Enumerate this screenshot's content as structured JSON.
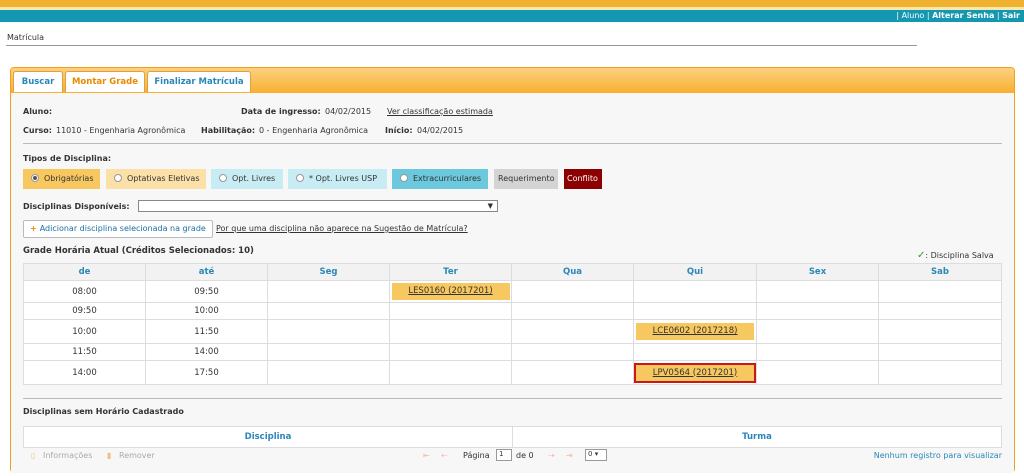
{
  "nav": {
    "sep": "|",
    "aluno": "Aluno",
    "alterar_senha": "Alterar Senha",
    "sair": "Sair"
  },
  "page": {
    "title": "Matrícula"
  },
  "tabs": [
    "Buscar",
    "Montar Grade",
    "Finalizar Matrícula"
  ],
  "info": {
    "aluno_label": "Aluno:",
    "ingresso_label": "Data de ingresso:",
    "ingresso_value": "04/02/2015",
    "classificacao_link": "Ver classificação estimada",
    "curso_label": "Curso:",
    "curso_value": "11010 - Engenharia Agronômica",
    "habilitacao_label": "Habilitação:",
    "habilitacao_value": "0 - Engenharia Agronômica",
    "inicio_label": "Início:",
    "inicio_value": "04/02/2015"
  },
  "tipos": {
    "label": "Tipos de Disciplina:",
    "items": [
      "Obrigatórias",
      "Optativas Eletivas",
      "Opt. Livres",
      "* Opt. Livres USP",
      "Extracurriculares",
      "Requerimento",
      "Conflito"
    ],
    "colors": {
      "obrigatorias": "#f8c860",
      "eletivas": "#fbe0a8",
      "livres": "#c8ecf4",
      "livres_usp": "#c8ecf4",
      "extra": "#6cc8dc",
      "requerimento": "#d4d4d4",
      "conflito": "#8b0000"
    }
  },
  "disponiveis": {
    "label": "Disciplinas Disponíveis:",
    "value": ""
  },
  "actions": {
    "add": "Adicionar disciplina selecionada na grade",
    "why_link": "Por que uma disciplina não aparece na Sugestão de Matrícula?"
  },
  "grade": {
    "title": "Grade Horária Atual (Créditos Selecionados: 10)",
    "saved_label": ": Disciplina Salva",
    "columns": [
      "de",
      "até",
      "Seg",
      "Ter",
      "Qua",
      "Qui",
      "Sex",
      "Sab"
    ],
    "rows": [
      {
        "de": "08:00",
        "ate": "09:50",
        "Ter": "LES0160 (2017201)"
      },
      {
        "de": "09:50",
        "ate": "10:00"
      },
      {
        "de": "10:00",
        "ate": "11:50",
        "Qui": "LCE0602 (2017218)"
      },
      {
        "de": "11:50",
        "ate": "14:00"
      },
      {
        "de": "14:00",
        "ate": "17:50",
        "Qui": "LPV0564 (2017201)"
      }
    ]
  },
  "sem_horario": {
    "title": "Disciplinas sem Horário Cadastrado",
    "columns": [
      "Disciplina",
      "Turma"
    ],
    "informacoes": "Informações",
    "remover": "Remover",
    "pagina": "Página",
    "page_value": "1",
    "de": "de 0",
    "per_page": "0",
    "empty": "Nenhum registro para visualizar"
  }
}
